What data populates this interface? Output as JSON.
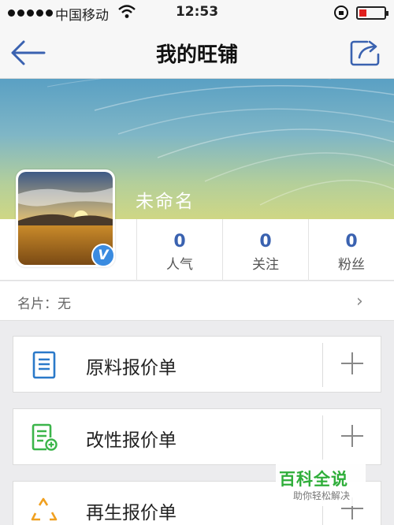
{
  "status_bar": {
    "carrier": "中国移动",
    "time": "12:53"
  },
  "nav": {
    "title": "我的旺铺",
    "back_icon": "back-arrow-icon",
    "share_icon": "share-icon"
  },
  "profile": {
    "name": "未命名",
    "verified_badge": "V"
  },
  "stats": [
    {
      "value": "0",
      "label": "人气"
    },
    {
      "value": "0",
      "label": "关注"
    },
    {
      "value": "0",
      "label": "粉丝"
    }
  ],
  "card": {
    "label": "名片：无",
    "chevron": "›"
  },
  "items": [
    {
      "label": "原料报价单",
      "icon": "document-icon",
      "color": "#2a79c9"
    },
    {
      "label": "改性报价单",
      "icon": "document-add-icon",
      "color": "#3bb54a"
    },
    {
      "label": "再生报价单",
      "icon": "recycle-icon",
      "color": "#f0a020"
    }
  ],
  "watermark": {
    "title": "百科全说",
    "subtitle": "助你轻松解决"
  },
  "colors": {
    "accent": "#3a62b0",
    "nav_bg": "#f7f7f7",
    "page_bg": "#ececee"
  }
}
